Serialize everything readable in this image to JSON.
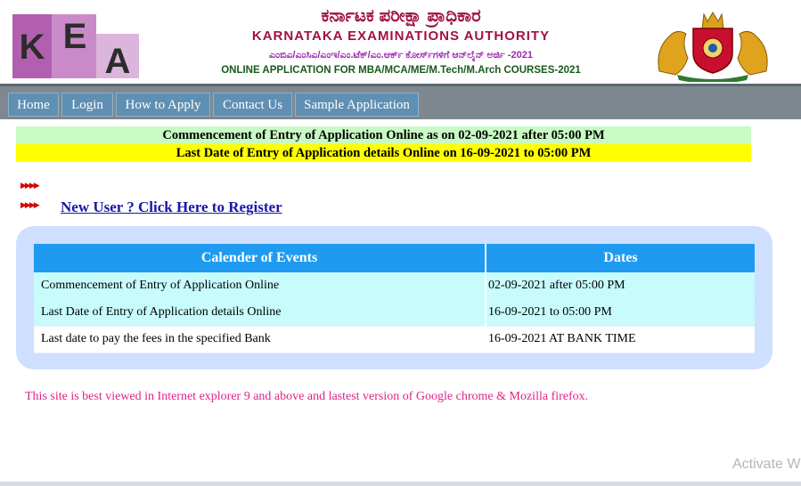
{
  "header": {
    "logo_letters": [
      "K",
      "E",
      "A"
    ],
    "title_kannada": "ಕರ್ನಾಟಕ ಪರೀಕ್ಷಾ ಪ್ರಾಧಿಕಾರ",
    "title_english": "KARNATAKA EXAMINATIONS AUTHORITY",
    "subtitle_kannada": "ಎಂಬಿಎ/ಎಂಸಿಎ/ಎಂಇ/ಎಂ.ಟೆಕ್/ಎಂ.ಆರ್ಕ್ ಕೋರ್ಸ್‌ಗಳಿಗೆ ಆನ್‌ಲೈನ್ ಅರ್ಜಿ -2021",
    "subtitle_english": "ONLINE APPLICATION FOR MBA/MCA/ME/M.Tech/M.Arch COURSES-2021"
  },
  "nav": {
    "items": [
      "Home",
      "Login",
      "How to Apply",
      "Contact Us",
      "Sample Application"
    ]
  },
  "notices": {
    "commencement": "Commencement of Entry of Application Online as on 02-09-2021 after 05:00 PM",
    "last_date": "Last Date of Entry of Application details Online on 16-09-2021 to 05:00 PM"
  },
  "links": {
    "register": "New User ? Click Here to Register"
  },
  "calendar": {
    "headers": [
      "Calender of Events",
      "Dates"
    ],
    "rows": [
      [
        "Commencement of Entry of Application Online",
        "02-09-2021 after 05:00 PM"
      ],
      [
        "Last Date of Entry of Application details Online",
        "16-09-2021 to 05:00 PM"
      ],
      [
        "Last date to pay the fees in the specified Bank",
        "16-09-2021 AT BANK TIME"
      ]
    ]
  },
  "footer": {
    "browser_note": "This site is best viewed in Internet explorer 9 and above and lastest version of Google chrome & Mozilla firefox."
  },
  "watermark": "Activate W",
  "colors": {
    "nav_button": "#5f8fb3",
    "table_header": "#1e9bf0",
    "panel_bg": "#cfdfff",
    "notice_green": "#c8fbc4",
    "notice_yellow": "#ffff00",
    "link": "#1a16a8",
    "footer_note": "#e0218a"
  }
}
